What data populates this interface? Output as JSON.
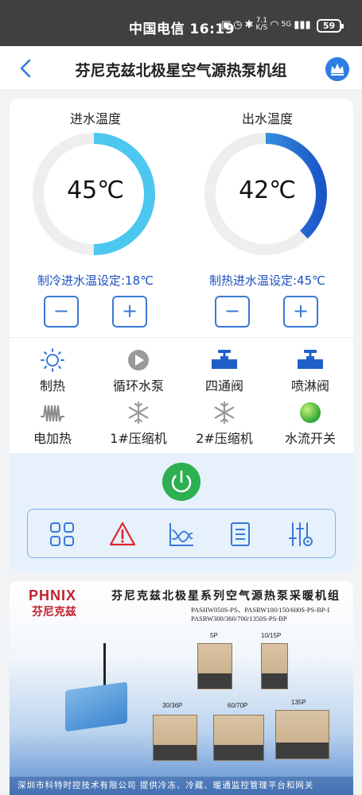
{
  "status_bar": {
    "carrier": "中国电信",
    "time": "16:19",
    "net_speed_value": "7.1",
    "net_speed_unit": "K/S",
    "signal": "5G",
    "battery": "59"
  },
  "header": {
    "title": "芬尼克兹北极星空气源热泵机组"
  },
  "gauges": [
    {
      "title": "进水温度",
      "value": "45℃",
      "fill": 0.5,
      "setpoint_label": "制冷进水温设定:18℃"
    },
    {
      "title": "出水温度",
      "value": "42℃",
      "fill": 0.38,
      "setpoint_label": "制热进水温设定:45℃"
    }
  ],
  "buttons": {
    "minus": "−",
    "plus": "+"
  },
  "status_items": [
    {
      "label": "制热",
      "icon": "sun-icon"
    },
    {
      "label": "循环水泵",
      "icon": "pump-icon"
    },
    {
      "label": "四通阀",
      "icon": "valve-icon"
    },
    {
      "label": "喷淋阀",
      "icon": "valve-icon"
    },
    {
      "label": "电加热",
      "icon": "heater-icon"
    },
    {
      "label": "1#压缩机",
      "icon": "snowflake-icon"
    },
    {
      "label": "2#压缩机",
      "icon": "snowflake-icon"
    },
    {
      "label": "水流开关",
      "icon": "green-dot-icon"
    }
  ],
  "toolbar_icons": [
    "grid-icon",
    "alarm-icon",
    "chart-icon",
    "list-icon",
    "settings-sliders-icon"
  ],
  "colors": {
    "accent_blue": "#3a78d8",
    "gauge_light": "#4cc7f0",
    "gauge_dark": "#1b56c9",
    "power_green": "#2daf52",
    "alarm_red": "#e0262b"
  },
  "banner": {
    "logo_en": "PHNIX",
    "logo_cn": "芬尼克兹",
    "title": "芬尼克兹北极星系列空气源热泵采暖机组",
    "models": [
      "PASHW050S-PS、PASRW100/150/600S-PS-BP-I",
      "PASRW300/360/700/1350S-PS-BP"
    ],
    "unit_tags": [
      "5P",
      "10/15P",
      "30/36P",
      "60/70P",
      "135P"
    ],
    "footer": "深圳市科特时控技术有限公司    提供冷冻、冷藏、暖通监控管理平台和网关"
  }
}
